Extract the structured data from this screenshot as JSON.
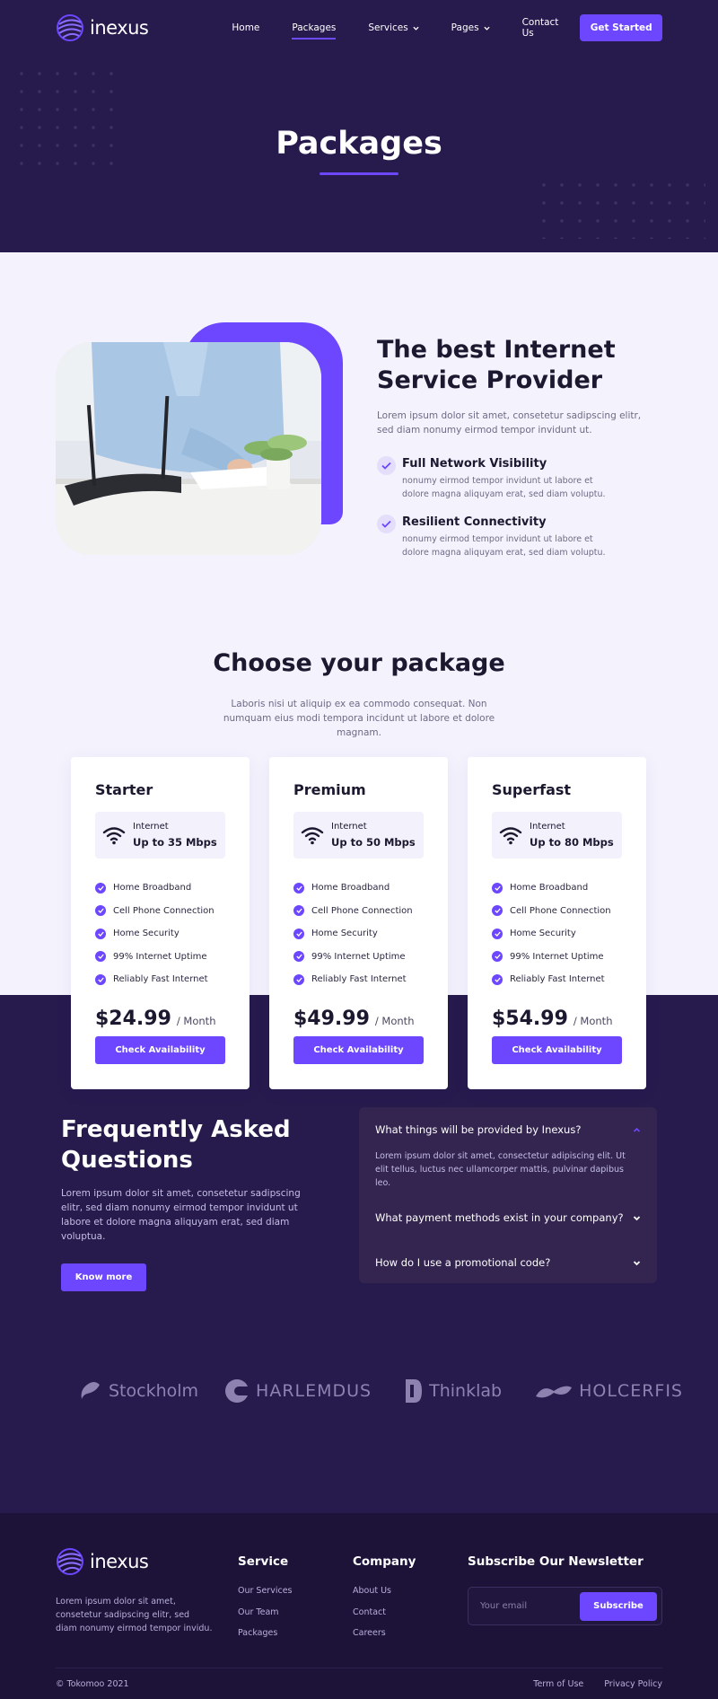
{
  "nav": {
    "logo_text": "inexus",
    "menu": [
      {
        "label": "Home",
        "dropdown": false,
        "active": false
      },
      {
        "label": "Packages",
        "dropdown": false,
        "active": true
      },
      {
        "label": "Services",
        "dropdown": true,
        "active": false
      },
      {
        "label": "Pages",
        "dropdown": true,
        "active": false
      },
      {
        "label": "Contact Us",
        "dropdown": false,
        "active": false
      }
    ],
    "cta_label": "Get Started"
  },
  "hero": {
    "title": "Packages"
  },
  "about": {
    "title": "The best Internet Service Provider",
    "description": "Lorem ipsum dolor sit amet, consetetur sadipscing elitr, sed diam nonumy eirmod tempor invidunt ut.",
    "features": [
      {
        "title": "Full Network Visibility",
        "description": "nonumy eirmod tempor invidunt ut labore et dolore magna aliquyam erat, sed diam voluptu."
      },
      {
        "title": "Resilient Connectivity",
        "description": "nonumy eirmod tempor invidunt ut labore et dolore magna aliquyam erat, sed diam voluptu."
      }
    ]
  },
  "packages": {
    "title": "Choose your package",
    "subtitle": "Laboris nisi ut aliquip ex ea commodo consequat. Non numquam eius modi tempora incidunt ut labore et dolore magnam.",
    "cards": [
      {
        "name": "Starter",
        "speed_label": "Internet",
        "speed_value": "Up to 35 Mbps",
        "features": [
          "Home Broadband",
          "Cell Phone Connection",
          "Home Security",
          "99% Internet Uptime",
          "Reliably Fast Internet"
        ],
        "price": "$24.99",
        "period": "/ Month",
        "button": "Check Availability"
      },
      {
        "name": "Premium",
        "speed_label": "Internet",
        "speed_value": "Up to 50 Mbps",
        "features": [
          "Home Broadband",
          "Cell Phone Connection",
          "Home Security",
          "99% Internet Uptime",
          "Reliably Fast Internet"
        ],
        "price": "$49.99",
        "period": "/ Month",
        "button": "Check Availability"
      },
      {
        "name": "Superfast",
        "speed_label": "Internet",
        "speed_value": "Up to 80 Mbps",
        "features": [
          "Home Broadband",
          "Cell Phone Connection",
          "Home Security",
          "99% Internet Uptime",
          "Reliably Fast Internet"
        ],
        "price": "$54.99",
        "period": "/ Month",
        "button": "Check Availability"
      }
    ]
  },
  "faq": {
    "title": "Frequently Asked Questions",
    "description": "Lorem ipsum dolor sit amet, consetetur sadipscing elitr, sed diam nonumy eirmod tempor invidunt ut labore et dolore magna aliquyam erat, sed diam voluptua.",
    "button": "Know more",
    "items": [
      {
        "question": "What things will be provided by Inexus?",
        "answer": "Lorem ipsum dolor sit amet, consectetur adipiscing elit. Ut elit tellus, luctus nec ullamcorper mattis, pulvinar dapibus leo.",
        "open": true
      },
      {
        "question": "What payment methods exist in your company?",
        "answer": "",
        "open": false
      },
      {
        "question": "How do I use a promotional code?",
        "answer": "",
        "open": false
      }
    ]
  },
  "brands": [
    "Stockholm",
    "HARLEMDUS",
    "Thinklab",
    "HOLCERFIS"
  ],
  "footer": {
    "logo_text": "inexus",
    "about": "Lorem ipsum dolor sit amet, consetetur sadipscing elitr, sed diam nonumy eirmod tempor invidu.",
    "service": {
      "title": "Service",
      "links": [
        "Our Services",
        "Our Team",
        "Packages"
      ]
    },
    "company": {
      "title": "Company",
      "links": [
        "About Us",
        "Contact",
        "Careers"
      ]
    },
    "newsletter": {
      "title": "Subscribe Our Newsletter",
      "placeholder": "Your email",
      "button": "Subscribe"
    },
    "copyright": "© Tokomoo 2021",
    "legal": [
      "Term of Use",
      "Privacy Policy"
    ]
  },
  "colors": {
    "accent": "#6c47ff",
    "dark": "#271a4d",
    "footer": "#1d1339",
    "light_bg": "#f4f2fd"
  }
}
